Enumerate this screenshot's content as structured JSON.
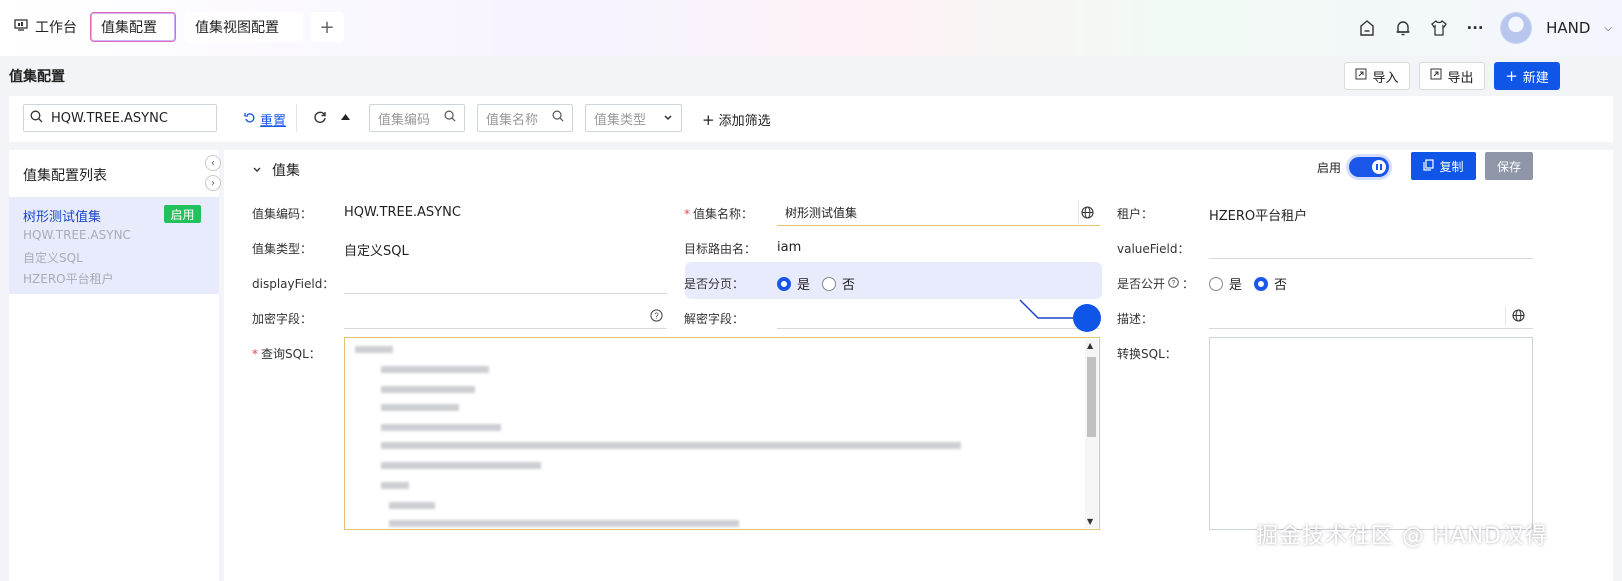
{
  "tabs": {
    "home": "工作台",
    "active": "值集配置",
    "second": "值集视图配置",
    "add": "+"
  },
  "user": {
    "name": "HAND"
  },
  "header": {
    "title": "值集配置",
    "import_label": "导入",
    "export_label": "导出",
    "new_label": "新建"
  },
  "filter": {
    "search_value": "HQW.TREE.ASYNC",
    "reset_label": "重置",
    "code_placeholder": "值集编码",
    "name_placeholder": "值集名称",
    "type_placeholder": "值集类型",
    "add_filter_label": "添加筛选"
  },
  "list": {
    "title": "值集配置列表",
    "items": [
      {
        "title": "树形测试值集",
        "code": "HQW.TREE.ASYNC",
        "type": "自定义SQL",
        "tenant": "HZERO平台租户",
        "badge": "启用"
      }
    ]
  },
  "detail": {
    "section_title": "值集",
    "enabled_label": "启用",
    "enabled": true,
    "copy_label": "复制",
    "save_label": "保存",
    "fields": {
      "code_label": "值集编码：",
      "code_value": "HQW.TREE.ASYNC",
      "name_label": "值集名称：",
      "name_value": "树形测试值集",
      "tenant_label": "租户：",
      "tenant_value": "HZERO平台租户",
      "type_label": "值集类型：",
      "type_value": "自定义SQL",
      "route_label": "目标路由名：",
      "route_value": "iam",
      "value_field_label": "valueField：",
      "display_field_label": "displayField：",
      "paged_label": "是否分页：",
      "paged_yes": "是",
      "paged_no": "否",
      "public_label": "是否公开",
      "public_colon": "：",
      "public_yes": "是",
      "public_no": "否",
      "encrypt_label": "加密字段：",
      "decrypt_label": "解密字段：",
      "desc_label": "描述：",
      "sql_label": "查询SQL：",
      "convert_label": "转换SQL："
    }
  },
  "watermark": "掘金技术社区 @ HAND汉得",
  "colors": {
    "primary": "#0e55e8",
    "success": "#21c25e",
    "required": "#e84545",
    "selection": "#e8ebfb"
  }
}
